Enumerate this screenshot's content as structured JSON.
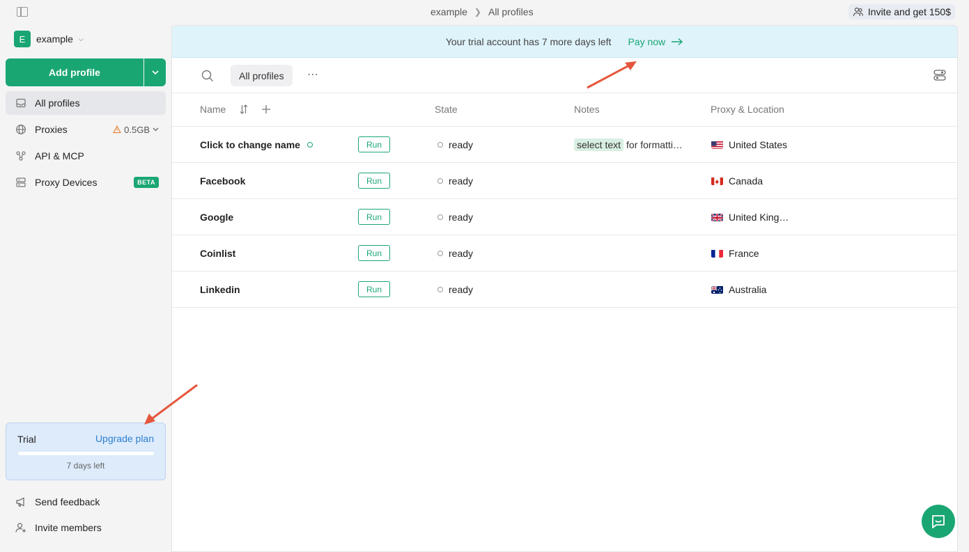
{
  "topbar": {
    "breadcrumb": [
      "example",
      "All profiles"
    ],
    "invite_label": "Invite and get 150$"
  },
  "sidebar": {
    "workspace_initial": "E",
    "workspace_name": "example",
    "add_profile_label": "Add profile",
    "items": [
      {
        "label": "All profiles",
        "icon": "inbox-icon"
      },
      {
        "label": "Proxies",
        "icon": "globe-icon",
        "extra": "0.5GB"
      },
      {
        "label": "API & MCP",
        "icon": "api-icon"
      },
      {
        "label": "Proxy Devices",
        "icon": "server-icon",
        "badge": "BETA"
      }
    ],
    "trial": {
      "label": "Trial",
      "upgrade_label": "Upgrade plan",
      "days_left": "7 days left",
      "progress": 0.0
    },
    "bottom_items": [
      {
        "label": "Send feedback",
        "icon": "megaphone-icon"
      },
      {
        "label": "Invite members",
        "icon": "user-plus-icon"
      }
    ]
  },
  "banner": {
    "text": "Your trial account has 7 more days left",
    "pay_label": "Pay now"
  },
  "toolbar": {
    "tab_label": "All profiles"
  },
  "table": {
    "columns": {
      "name": "Name",
      "state": "State",
      "notes": "Notes",
      "location": "Proxy & Location"
    },
    "run_label": "Run",
    "rows": [
      {
        "name": "Click to change name",
        "state": "ready",
        "note_highlight": "select text",
        "note_rest": "for formatti…",
        "location": "United States",
        "flag": "us"
      },
      {
        "name": "Facebook",
        "state": "ready",
        "note_highlight": "",
        "note_rest": "",
        "location": "Canada",
        "flag": "ca"
      },
      {
        "name": "Google",
        "state": "ready",
        "note_highlight": "",
        "note_rest": "",
        "location": "United King…",
        "flag": "gb"
      },
      {
        "name": "Coinlist",
        "state": "ready",
        "note_highlight": "",
        "note_rest": "",
        "location": "France",
        "flag": "fr"
      },
      {
        "name": "Linkedin",
        "state": "ready",
        "note_highlight": "",
        "note_rest": "",
        "location": "Australia",
        "flag": "au"
      }
    ]
  },
  "colors": {
    "accent": "#1aa673",
    "banner_bg": "#dff3fb",
    "trial_bg": "#ddebfb",
    "annotation_arrow": "#e4573d"
  }
}
